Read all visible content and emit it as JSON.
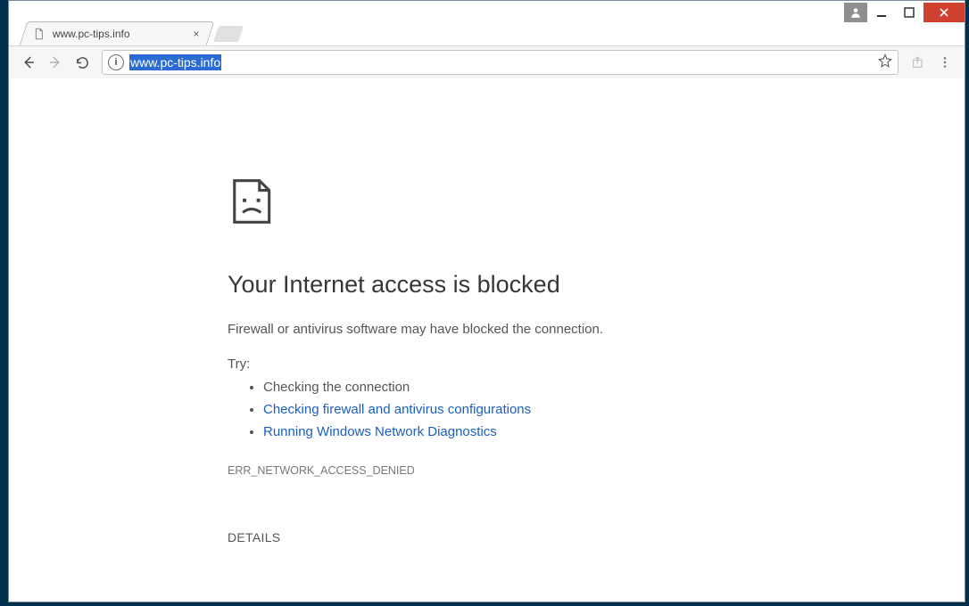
{
  "window": {
    "titlebar": {
      "user_icon": "user-icon",
      "minimize": "—",
      "maximize": "▢",
      "close": "×"
    }
  },
  "tab": {
    "title": "www.pc-tips.info",
    "close_glyph": "×"
  },
  "toolbar": {
    "site_info_glyph": "i",
    "url_selected": "www.pc-tips.info"
  },
  "error": {
    "title": "Your Internet access is blocked",
    "description": "Firewall or antivirus software may have blocked the connection.",
    "try_label": "Try:",
    "suggestions": {
      "s0": "Checking the connection",
      "s1": "Checking firewall and antivirus configurations",
      "s2": "Running Windows Network Diagnostics"
    },
    "code": "ERR_NETWORK_ACCESS_DENIED",
    "details_label": "DETAILS"
  }
}
